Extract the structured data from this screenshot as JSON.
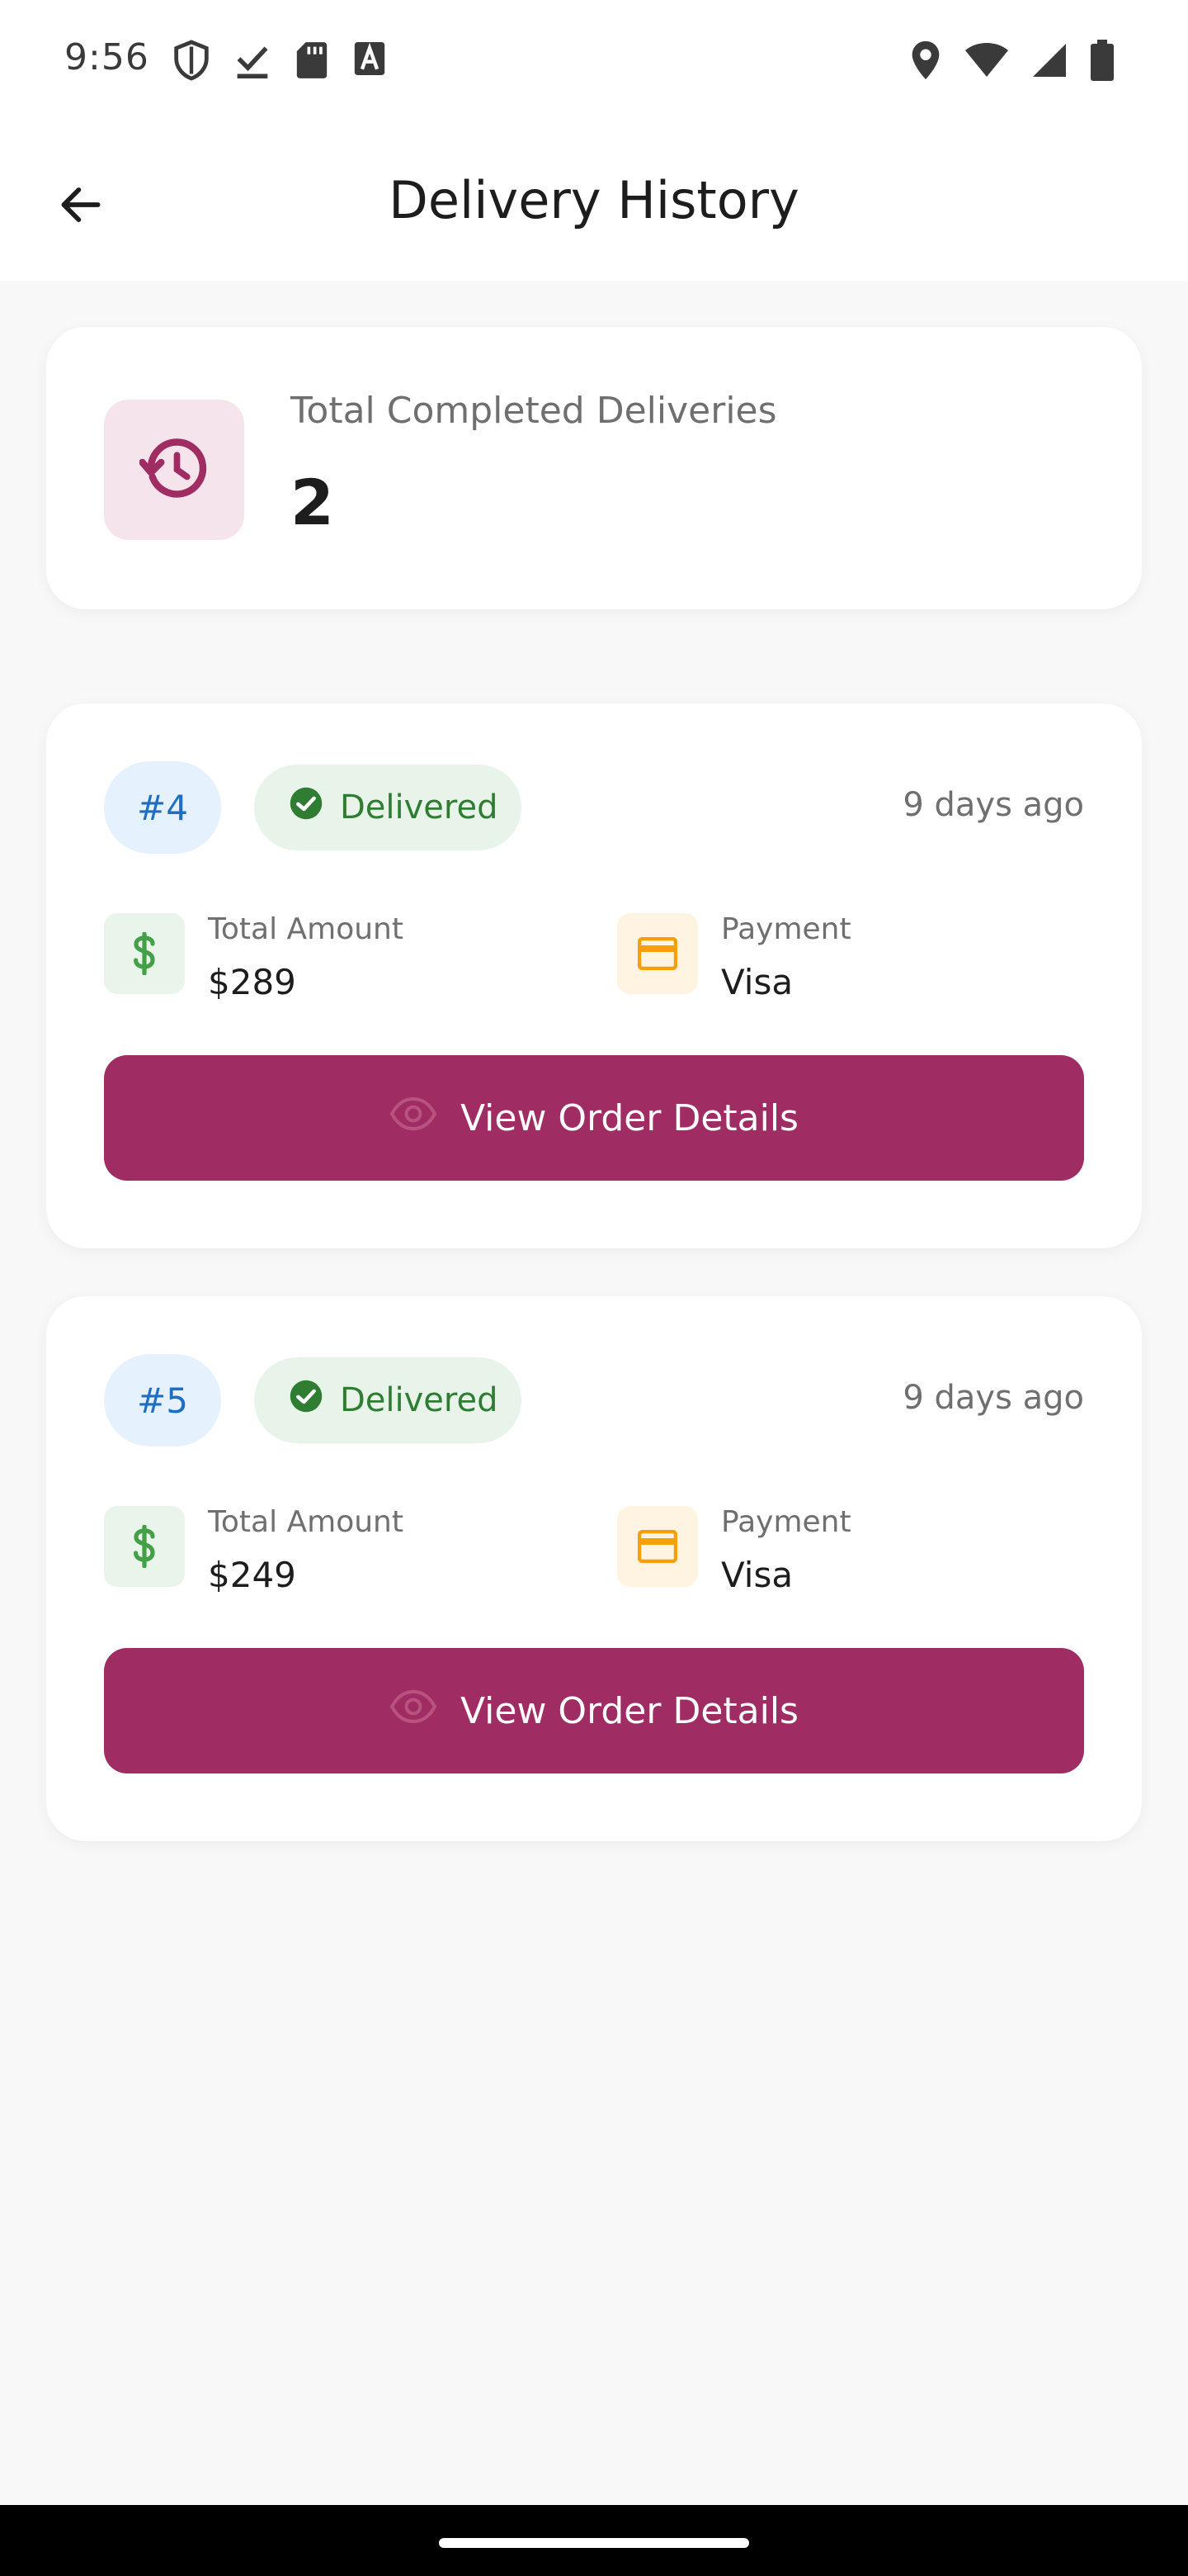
{
  "status_bar": {
    "time": "9:56",
    "left_icons": [
      "shield-icon",
      "download-done-icon",
      "sd-card-icon",
      "text-a-icon"
    ],
    "right_icons": [
      "location-icon",
      "wifi-icon",
      "signal-icon",
      "battery-icon"
    ]
  },
  "header": {
    "title": "Delivery History",
    "back_icon": "arrow-back-icon"
  },
  "summary": {
    "label": "Total Completed Deliveries",
    "value": "2",
    "icon": "history-icon",
    "icon_color": "#a02c64"
  },
  "orders": [
    {
      "id": "#4",
      "status": "Delivered",
      "time_ago": "9 days ago",
      "amount_label": "Total Amount",
      "amount": "$289",
      "payment_label": "Payment",
      "payment": "Visa",
      "button_label": "View Order Details"
    },
    {
      "id": "#5",
      "status": "Delivered",
      "time_ago": "9 days ago",
      "amount_label": "Total Amount",
      "amount": "$249",
      "payment_label": "Payment",
      "payment": "Visa",
      "button_label": "View Order Details"
    }
  ],
  "colors": {
    "primary": "#a02c64",
    "status_green": "#2e7d32",
    "id_blue": "#1e6fc4",
    "money_green": "#43a047",
    "card_orange": "#f59f0a"
  }
}
